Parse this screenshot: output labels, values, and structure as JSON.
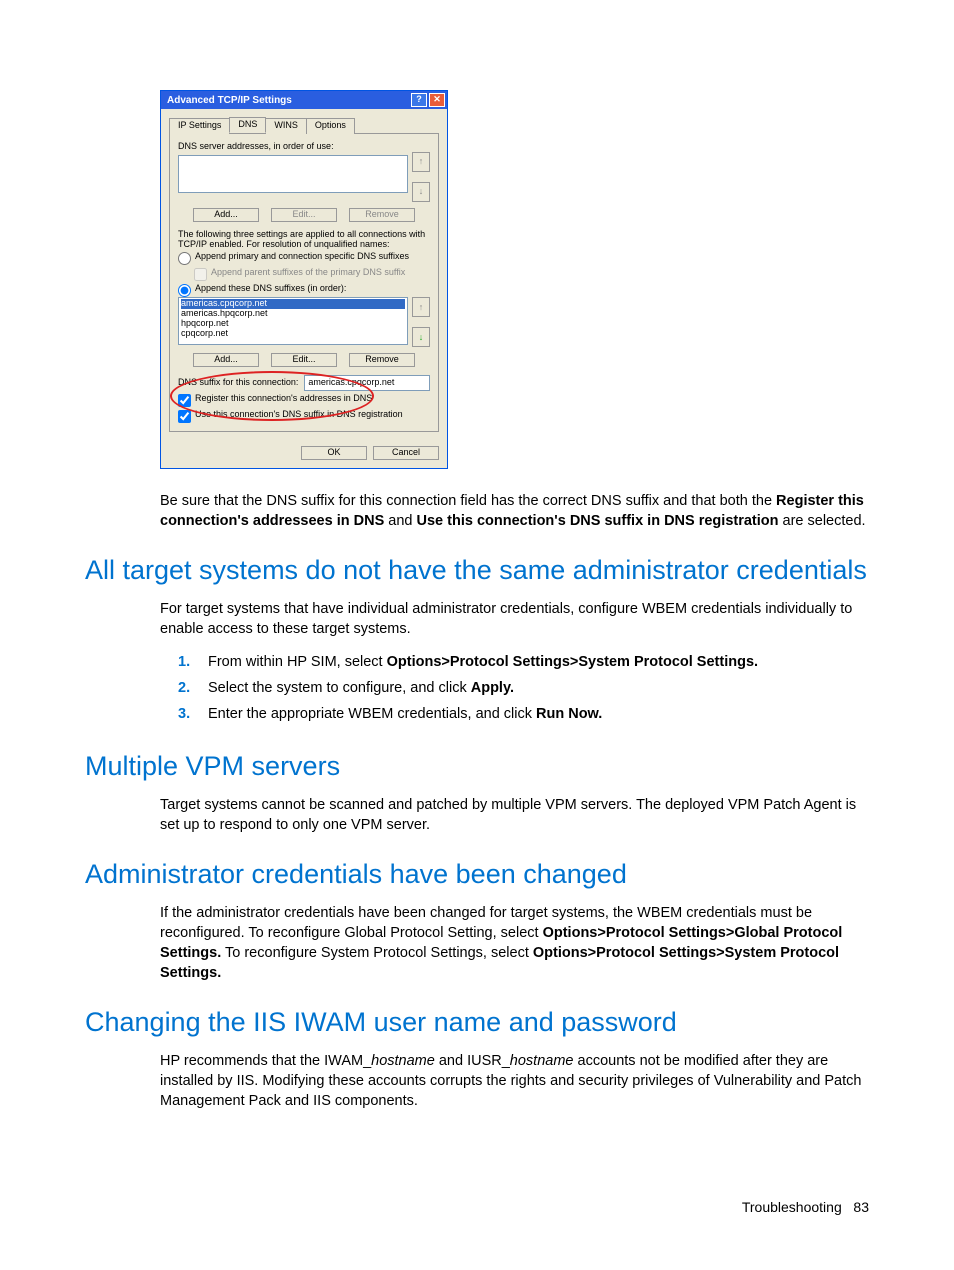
{
  "dialog": {
    "title": "Advanced TCP/IP Settings",
    "tabs": [
      "IP Settings",
      "DNS",
      "WINS",
      "Options"
    ],
    "dns_label": "DNS server addresses, in order of use:",
    "btn_add": "Add...",
    "btn_edit": "Edit...",
    "btn_remove": "Remove",
    "three_settings": "The following three settings are applied to all connections with TCP/IP enabled. For resolution of unqualified names:",
    "radio_primary": "Append primary and connection specific DNS suffixes",
    "check_parent": "Append parent suffixes of the primary DNS suffix",
    "radio_these": "Append these DNS suffixes (in order):",
    "suffixes": [
      "americas.cpqcorp.net",
      "americas.hpqcorp.net",
      "hpqcorp.net",
      "cpqcorp.net"
    ],
    "suffix_label": "DNS suffix for this connection:",
    "suffix_value": "americas.cpqcorp.net",
    "check_register": "Register this connection's addresses in DNS",
    "check_use": "Use this connection's DNS suffix in DNS registration",
    "ok": "OK",
    "cancel": "Cancel"
  },
  "p_after_dialog_1": "Be sure that the DNS suffix for this connection field has the correct DNS suffix and that both the ",
  "p_after_dialog_bold1": "Register this connection's addressees in DNS",
  "p_after_dialog_mid": " and ",
  "p_after_dialog_bold2": "Use this connection's DNS suffix in DNS registration",
  "p_after_dialog_2": " are selected.",
  "h_creds": "All target systems do not have the same administrator credentials",
  "p_creds": "For target systems that have individual administrator credentials, configure WBEM credentials individually to enable access to these target systems.",
  "step1_a": "From within HP SIM, select ",
  "step1_b": "Options>Protocol Settings>System Protocol Settings.",
  "step2_a": "Select the system to configure, and click ",
  "step2_b": "Apply.",
  "step3_a": "Enter the appropriate WBEM credentials, and click ",
  "step3_b": "Run Now.",
  "h_vpm": "Multiple VPM servers",
  "p_vpm": "Target systems cannot be scanned and patched by multiple VPM servers. The deployed VPM Patch Agent is set up to respond to only one VPM server.",
  "h_admin": "Administrator credentials have been changed",
  "p_admin_1": "If the administrator credentials have been changed for target systems, the WBEM credentials must be reconfigured. To reconfigure Global Protocol Setting, select ",
  "p_admin_b1": "Options>Protocol Settings>Global Protocol Settings.",
  "p_admin_2": " To reconfigure System Protocol Settings, select ",
  "p_admin_b2": "Options>Protocol Settings>System Protocol Settings.",
  "h_iis": "Changing the IIS IWAM user name and password",
  "p_iis_1": "HP recommends that the IWAM_",
  "p_iis_i1": "hostname",
  "p_iis_2": " and IUSR_",
  "p_iis_i2": "hostname",
  "p_iis_3": " accounts not be modified after they are installed by IIS. Modifying these accounts corrupts the rights and security privileges of Vulnerability and Patch Management Pack and IIS components.",
  "footer_label": "Troubleshooting",
  "footer_page": "83"
}
